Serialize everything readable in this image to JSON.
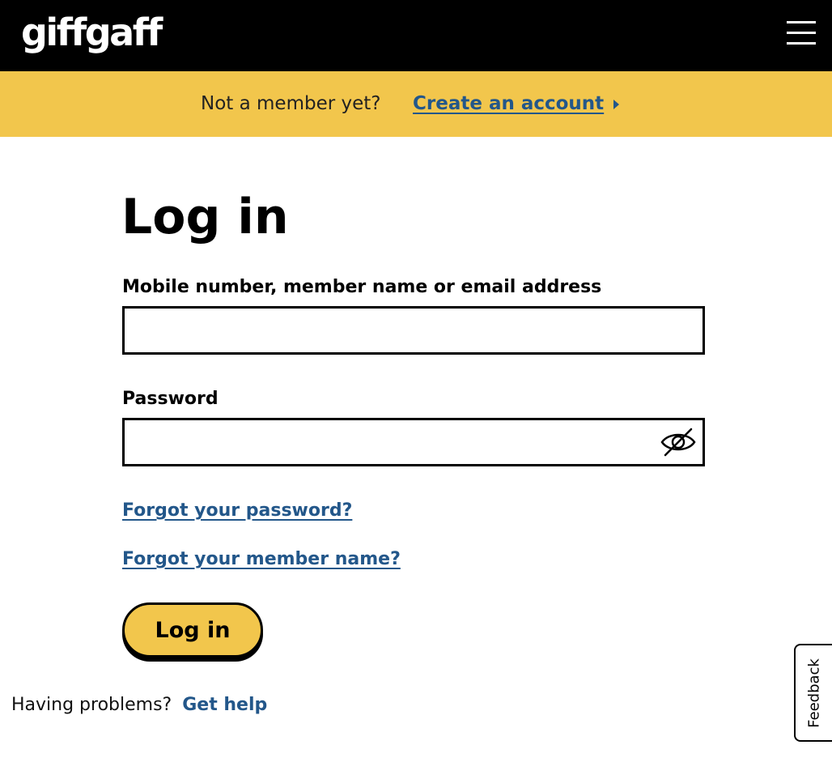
{
  "header": {
    "logo_text": "giffgaff",
    "menu_icon": "hamburger-menu-icon"
  },
  "promo": {
    "prompt": "Not a member yet?",
    "link_label": "Create an account",
    "link_icon": "caret-right-icon",
    "background_color": "#f2c64c"
  },
  "login": {
    "title": "Log in",
    "username_label": "Mobile number, member name or email address",
    "username_value": "",
    "password_label": "Password",
    "password_value": "",
    "password_toggle_icon": "eye-slash-icon",
    "forgot_password": "Forgot your password?",
    "forgot_member_name": "Forgot your member name?",
    "submit_label": "Log in"
  },
  "help": {
    "prompt": "Having problems?",
    "link_label": "Get help"
  },
  "feedback": {
    "label": "Feedback"
  },
  "colors": {
    "header_bg": "#000000",
    "accent_yellow": "#f2c64c",
    "link_blue": "#23578a",
    "text": "#000000"
  }
}
